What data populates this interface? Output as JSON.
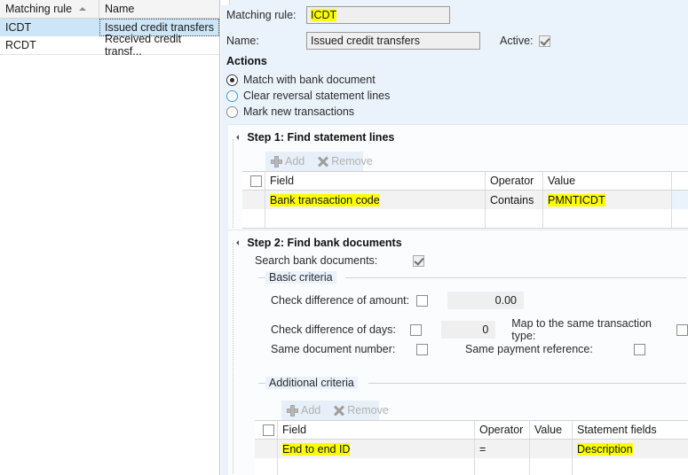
{
  "left_grid": {
    "columns": [
      "Matching rule",
      "Name"
    ],
    "sort_indicator": "sort-ascending-icon",
    "rows": [
      {
        "rule": "ICDT",
        "name": "Issued credit transfers",
        "selected": true
      },
      {
        "rule": "RCDT",
        "name": "Received credit transf...",
        "selected": false
      }
    ]
  },
  "form": {
    "matching_rule_label": "Matching rule:",
    "matching_rule_value": "ICDT",
    "name_label": "Name:",
    "name_value": "Issued credit transfers",
    "active_label": "Active:",
    "actions_title": "Actions",
    "actions": [
      {
        "label": "Match with bank document",
        "selected": true
      },
      {
        "label": "Clear reversal statement lines",
        "selected": false
      },
      {
        "label": "Mark new transactions",
        "selected": false
      }
    ]
  },
  "step1": {
    "title": "Step 1: Find statement lines",
    "toolbar": {
      "add": "Add",
      "remove": "Remove"
    },
    "columns": [
      "Field",
      "Operator",
      "Value"
    ],
    "rows": [
      {
        "field": "Bank transaction code",
        "operator": "Contains",
        "value": "PMNTICDT"
      }
    ]
  },
  "step2": {
    "title": "Step 2: Find bank documents",
    "search_label": "Search bank documents:",
    "basic_criteria_label": "Basic criteria",
    "basic": {
      "check_amount_label": "Check difference of amount:",
      "check_amount_value": "0.00",
      "check_days_label": "Check difference of days:",
      "check_days_value": "0",
      "same_doc_label": "Same document number:",
      "map_same_type_label": "Map to the same transaction type:",
      "same_pay_ref_label": "Same payment reference:"
    },
    "additional_criteria_label": "Additional criteria",
    "toolbar": {
      "add": "Add",
      "remove": "Remove"
    },
    "columns": [
      "Field",
      "Operator",
      "Value",
      "Statement fields"
    ],
    "rows": [
      {
        "field": "End to end ID",
        "operator": "=",
        "value": "",
        "statement_fields": "Description"
      }
    ]
  },
  "colors": {
    "form_bg": "#eaf2fc",
    "highlight": "#ffff00",
    "row_selected": "#cde6f7"
  }
}
